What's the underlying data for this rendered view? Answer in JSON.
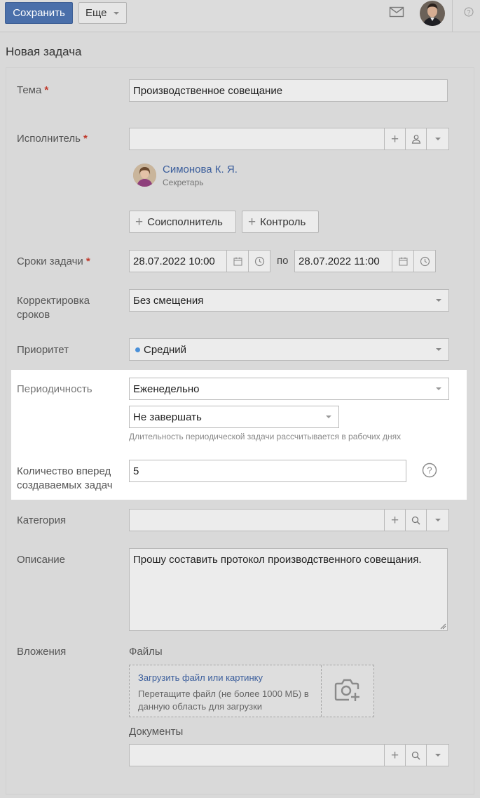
{
  "toolbar": {
    "save_label": "Сохранить",
    "more_label": "Еще",
    "icons": [
      "mail-icon",
      "avatar",
      "help-icon"
    ]
  },
  "page": {
    "title": "Новая задача"
  },
  "form": {
    "subject": {
      "label": "Тема",
      "value": "Производственное совещание"
    },
    "assignee": {
      "label": "Исполнитель",
      "value": "",
      "person_name": "Симонова К. Я.",
      "person_role": "Секретарь",
      "coexecutor_label": "Соисполнитель",
      "control_label": "Контроль"
    },
    "deadline": {
      "label": "Сроки задачи",
      "from": "28.07.2022  10:00",
      "separator": "по",
      "to": "28.07.2022  11:00"
    },
    "correction": {
      "label_line1": "Корректировка",
      "label_line2": "сроков",
      "value": "Без смещения"
    },
    "priority": {
      "label": "Приоритет",
      "value": "Средний",
      "dot_color": "#4a90d9"
    },
    "periodicity": {
      "label": "Периодичность",
      "value": "Еженедельно",
      "end_value": "Не завершать",
      "hint": "Длительность периодической задачи рассчитывается в рабочих днях"
    },
    "ahead_count": {
      "label_line1": "Количество вперед",
      "label_line2": "создаваемых задач",
      "value": "5"
    },
    "category": {
      "label": "Категория",
      "value": ""
    },
    "description": {
      "label": "Описание",
      "value": "Прошу составить протокол производственного совещания."
    },
    "attachments": {
      "label": "Вложения",
      "files_label": "Файлы",
      "upload_link": "Загрузить файл или картинку",
      "upload_hint": "Перетащите файл (не более 1000 МБ) в данную область для загрузки",
      "documents_label": "Документы",
      "documents_value": ""
    }
  },
  "colors": {
    "accent": "#4a6faa",
    "link": "#3b5e9c",
    "required": "#c0392b"
  }
}
